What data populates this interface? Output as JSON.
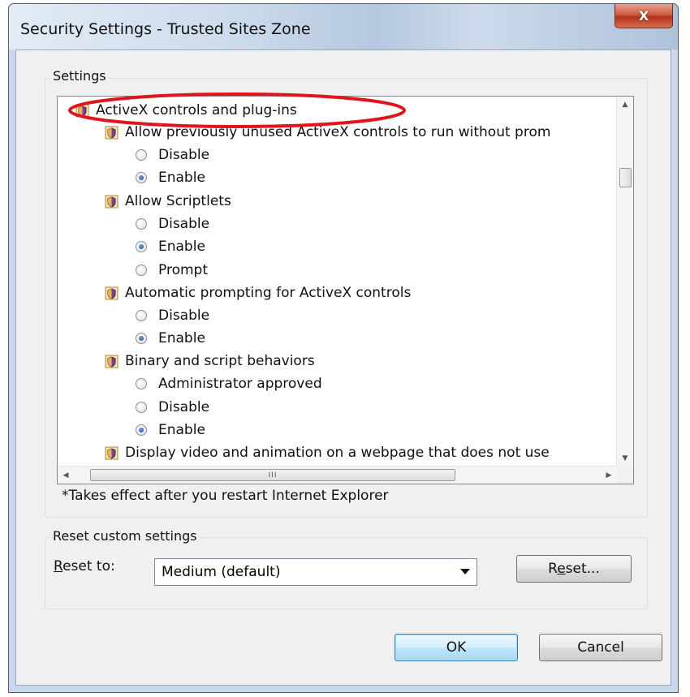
{
  "window": {
    "title": "Security Settings - Trusted Sites Zone",
    "close_label": "X"
  },
  "settings_group": {
    "label": "Settings",
    "tree": {
      "category": "ActiveX controls and plug-ins",
      "items": [
        {
          "label": "Allow previously unused ActiveX controls to run without prom",
          "options": [
            {
              "label": "Disable",
              "checked": false
            },
            {
              "label": "Enable",
              "checked": true
            }
          ]
        },
        {
          "label": "Allow Scriptlets",
          "options": [
            {
              "label": "Disable",
              "checked": false
            },
            {
              "label": "Enable",
              "checked": true
            },
            {
              "label": "Prompt",
              "checked": false
            }
          ]
        },
        {
          "label": "Automatic prompting for ActiveX controls",
          "options": [
            {
              "label": "Disable",
              "checked": false
            },
            {
              "label": "Enable",
              "checked": true
            }
          ]
        },
        {
          "label": "Binary and script behaviors",
          "options": [
            {
              "label": "Administrator approved",
              "checked": false
            },
            {
              "label": "Disable",
              "checked": false
            },
            {
              "label": "Enable",
              "checked": true
            }
          ]
        },
        {
          "label": "Display video and animation on a webpage that does not use",
          "options": []
        }
      ],
      "hscroll_grip": "III"
    },
    "note": "*Takes effect after you restart Internet Explorer"
  },
  "reset_group": {
    "label": "Reset custom settings",
    "reset_to_label_first": "R",
    "reset_to_label_rest": "eset to:",
    "selected_level": "Medium (default)",
    "reset_button_prefix": "R",
    "reset_button_underlined": "e",
    "reset_button_suffix": "set..."
  },
  "footer": {
    "ok_label": "OK",
    "cancel_label": "Cancel"
  },
  "colors": {
    "annotation_ellipse": "#e0141b",
    "default_button_border": "#3c7fb1"
  }
}
